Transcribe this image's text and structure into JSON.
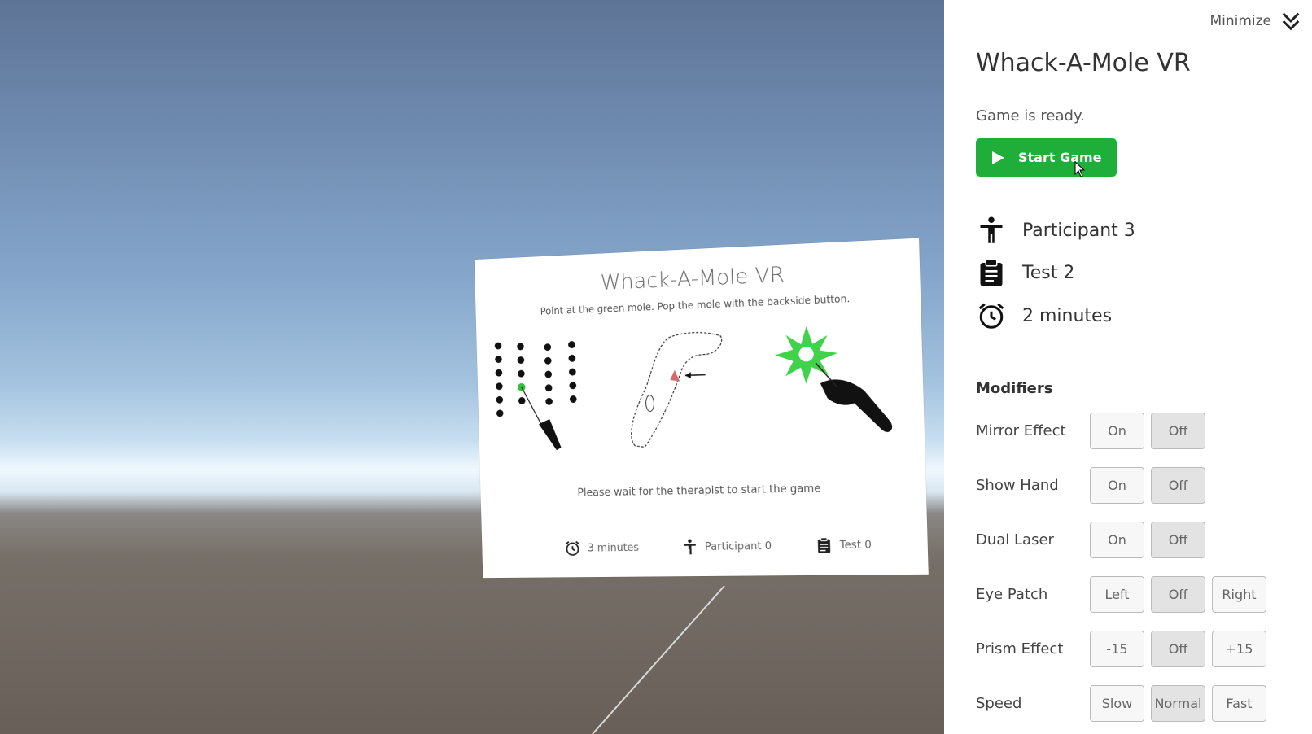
{
  "scene": {
    "card": {
      "title": "Whack-A-Mole VR",
      "instruction": "Point at the green mole. Pop the mole with the backside button.",
      "wait_message": "Please wait for the therapist to start the game",
      "footer": {
        "duration": "3 minutes",
        "participant": "Participant 0",
        "test": "Test 0"
      }
    }
  },
  "panel": {
    "minimize_label": "Minimize",
    "title": "Whack-A-Mole VR",
    "status": "Game is ready.",
    "start_button": "Start Game",
    "info": {
      "participant": "Participant 3",
      "test": "Test 2",
      "duration": "2 minutes"
    },
    "modifiers_title": "Modifiers",
    "modifiers": [
      {
        "label": "Mirror Effect",
        "options": [
          "On",
          "Off"
        ],
        "selected": "Off"
      },
      {
        "label": "Show Hand",
        "options": [
          "On",
          "Off"
        ],
        "selected": "Off"
      },
      {
        "label": "Dual Laser",
        "options": [
          "On",
          "Off"
        ],
        "selected": "Off"
      },
      {
        "label": "Eye Patch",
        "options": [
          "Left",
          "Off",
          "Right"
        ],
        "selected": "Off"
      },
      {
        "label": "Prism Effect",
        "options": [
          "-15",
          "Off",
          "+15"
        ],
        "selected": "Off"
      },
      {
        "label": "Speed",
        "options": [
          "Slow",
          "Normal",
          "Fast"
        ],
        "selected": "Normal"
      }
    ]
  },
  "icons": {
    "participant": "person-icon",
    "test": "clipboard-icon",
    "duration": "alarm-clock-icon",
    "start": "play-icon",
    "minimize": "double-chevron-down-icon"
  },
  "colors": {
    "start_button": "#1fae3a",
    "mole_active": "#2fbf3a",
    "selected_toggle": "#e3e3e3"
  }
}
